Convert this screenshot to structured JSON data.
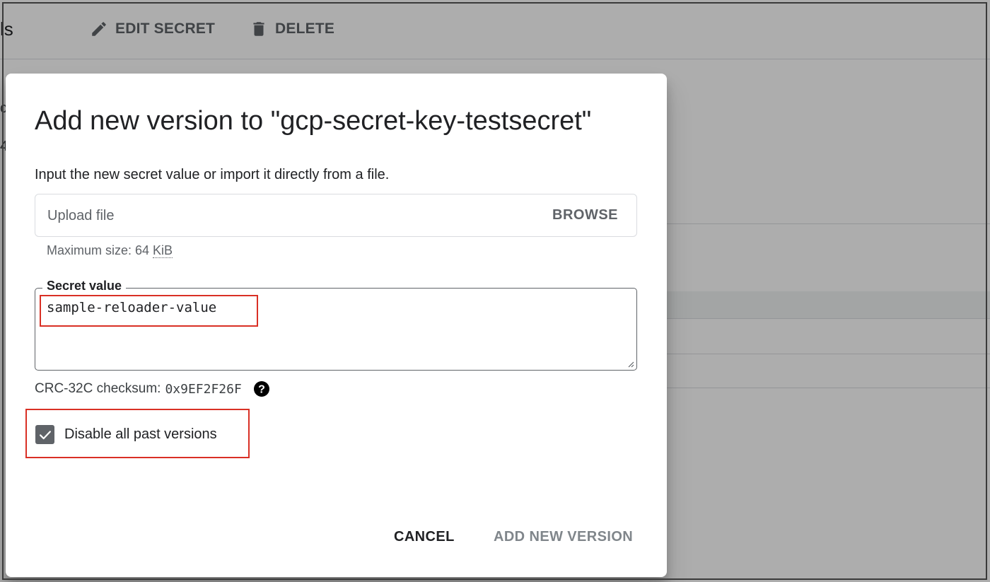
{
  "background": {
    "title_fragment": "ls",
    "toolbar": {
      "edit_label": "EDIT SECRET",
      "edit_icon": "pencil-icon",
      "delete_label": "DELETE",
      "delete_icon": "trash-icon"
    }
  },
  "dialog": {
    "title": "Add new version to \"gcp-secret-key-testsecret\"",
    "description": "Input the new secret value or import it directly from a file.",
    "upload": {
      "placeholder": "Upload file",
      "browse_label": "BROWSE",
      "max_size_prefix": "Maximum size: 64 ",
      "max_size_unit": "KiB"
    },
    "secret": {
      "label": "Secret value",
      "value": "sample-reloader-value"
    },
    "checksum": {
      "label": "CRC-32C checksum:",
      "value": "0x9EF2F26F",
      "help_icon": "help-circle-icon"
    },
    "disable_past": {
      "label": "Disable all past versions",
      "checked": true
    },
    "actions": {
      "cancel_label": "CANCEL",
      "add_label": "ADD NEW VERSION"
    }
  },
  "colors": {
    "highlight": "#d93025",
    "scrim": "rgba(0,0,0,0.32)",
    "checkbox": "#5f6368"
  }
}
